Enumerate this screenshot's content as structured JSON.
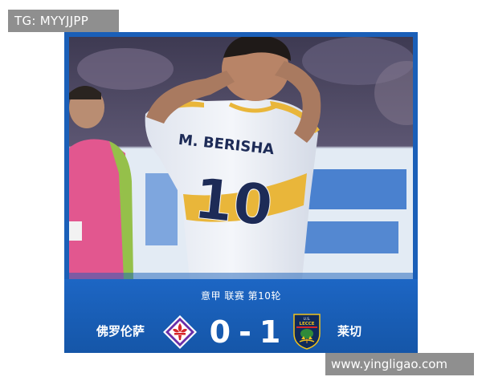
{
  "overlay": {
    "tg_label": "TG: MYYJJPP",
    "site_label": "www.yingligao.com"
  },
  "photo": {
    "jersey_name": "M. BERISHA",
    "jersey_number": "10"
  },
  "match": {
    "league_line": "意甲 联赛 第10轮",
    "home_team": "佛罗伦萨",
    "away_team": "莱切",
    "home_score": "0",
    "separator": "-",
    "away_score": "1"
  },
  "crests": {
    "away_crest_text": "U.S. LECCE",
    "home_crest_icon": "fiorentina-lily-crest",
    "away_crest_icon": "lecce-shield-crest"
  },
  "colors": {
    "scorebar": "#1a5fb8",
    "fiorentina_purple": "#6a2ea8",
    "lecce_yellow": "#f1c21b",
    "lecce_navy": "#0f2a5c"
  }
}
